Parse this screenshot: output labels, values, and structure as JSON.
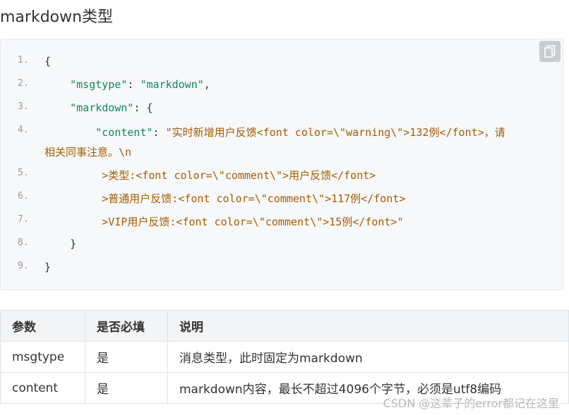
{
  "heading": "markdown类型",
  "code": {
    "copy_icon": "copy-icon",
    "lines": [
      {
        "num": "1.",
        "parts": [
          {
            "t": "{",
            "c": "p"
          }
        ]
      },
      {
        "num": "2.",
        "parts": [
          {
            "t": "    \"msgtype\"",
            "c": "k"
          },
          {
            "t": ": ",
            "c": "p"
          },
          {
            "t": "\"markdown\"",
            "c": "k"
          },
          {
            "t": ",",
            "c": "p"
          }
        ]
      },
      {
        "num": "3.",
        "parts": [
          {
            "t": "    \"markdown\"",
            "c": "k"
          },
          {
            "t": ": {",
            "c": "p"
          }
        ]
      },
      {
        "num": "4.",
        "parts": [
          {
            "t": "        \"content\"",
            "c": "k"
          },
          {
            "t": ": ",
            "c": "p"
          },
          {
            "t": "\"实时新增用户反馈<font color=\\\"warning\\\">132例</font>，请",
            "c": "s"
          }
        ]
      },
      {
        "num": "",
        "parts": [
          {
            "t": "相关同事注意。\\n",
            "c": "s"
          }
        ]
      },
      {
        "num": "5.",
        "parts": [
          {
            "t": "         >类型:<font color=\\\"comment\\\">用户反馈</font>",
            "c": "s"
          }
        ]
      },
      {
        "num": "6.",
        "parts": [
          {
            "t": "         >普通用户反馈:<font color=\\\"comment\\\">117例</font>",
            "c": "s"
          }
        ]
      },
      {
        "num": "7.",
        "parts": [
          {
            "t": "         >VIP用户反馈:<font color=\\\"comment\\\">15例</font>\"",
            "c": "s"
          }
        ]
      },
      {
        "num": "8.",
        "parts": [
          {
            "t": "    }",
            "c": "p"
          }
        ]
      },
      {
        "num": "9.",
        "parts": [
          {
            "t": "}",
            "c": "p"
          }
        ]
      }
    ]
  },
  "table": {
    "headers": [
      "参数",
      "是否必填",
      "说明"
    ],
    "rows": [
      [
        "msgtype",
        "是",
        "消息类型，此时固定为markdown"
      ],
      [
        "content",
        "是",
        "markdown内容，最长不超过4096个字节，必须是utf8编码"
      ]
    ]
  },
  "watermark": "CSDN @这辈子的error都记在这里"
}
